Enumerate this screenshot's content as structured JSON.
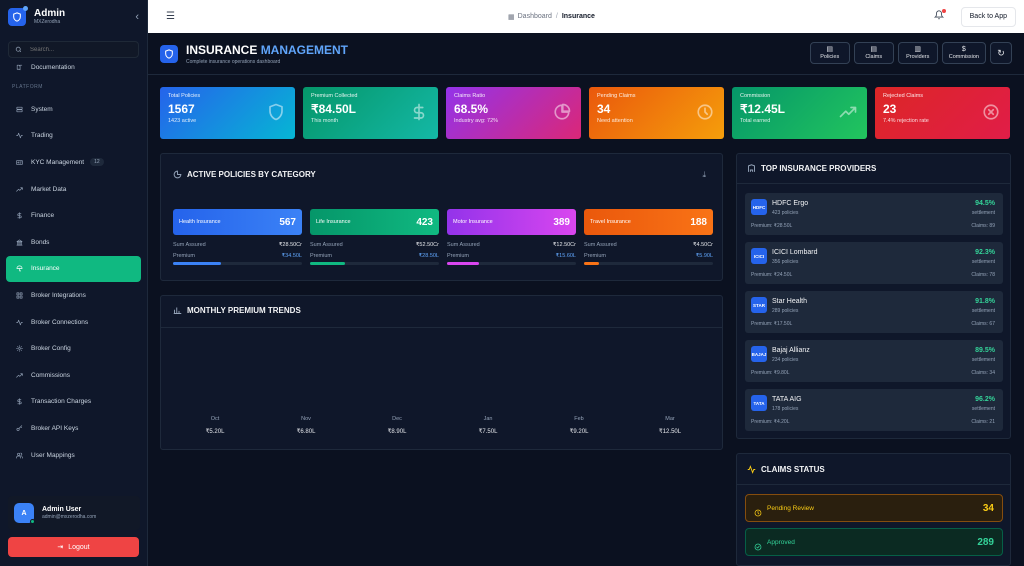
{
  "sidebar": {
    "brand_title": "Admin",
    "brand_sub": "MXZerodha",
    "search_placeholder": "Search...",
    "top_items": [
      {
        "label": "Documentation",
        "icon": "book-icon"
      }
    ],
    "section_label": "PLATFORM",
    "items": [
      {
        "label": "System",
        "icon": "server-icon"
      },
      {
        "label": "Trading",
        "icon": "activity-icon"
      },
      {
        "label": "KYC Management",
        "icon": "id-card-icon",
        "badge": "12"
      },
      {
        "label": "Market Data",
        "icon": "trending-up-icon"
      },
      {
        "label": "Finance",
        "icon": "dollar-icon"
      },
      {
        "label": "Bonds",
        "icon": "bank-icon"
      },
      {
        "label": "Insurance",
        "icon": "umbrella-icon",
        "active": true
      },
      {
        "label": "Broker Integrations",
        "icon": "grid-icon"
      },
      {
        "label": "Broker Connections",
        "icon": "activity-icon"
      },
      {
        "label": "Broker Config",
        "icon": "gear-icon"
      },
      {
        "label": "Commissions",
        "icon": "trending-up-icon"
      },
      {
        "label": "Transaction Charges",
        "icon": "dollar-icon"
      },
      {
        "label": "Broker API Keys",
        "icon": "key-icon"
      },
      {
        "label": "User Mappings",
        "icon": "users-icon"
      }
    ],
    "user": {
      "initial": "A",
      "name": "Admin User",
      "email": "admin@mxzerodha.com"
    },
    "logout_label": "Logout"
  },
  "topbar": {
    "breadcrumb_home": "Dashboard",
    "breadcrumb_current": "Insurance",
    "back_label": "Back to App"
  },
  "header": {
    "title_main": "INSURANCE",
    "title_accent": "MANAGEMENT",
    "subtitle": "Complete insurance operations dashboard",
    "actions": [
      "Policies",
      "Claims",
      "Providers",
      "Commission"
    ]
  },
  "stats": [
    {
      "label": "Total Policies",
      "value": "1567",
      "sub": "1423 active",
      "color_from": "#2563eb",
      "color_to": "#06b6d4",
      "icon": "shield-icon"
    },
    {
      "label": "Premium Collected",
      "value": "₹84.50L",
      "sub": "This month",
      "color_from": "#059669",
      "color_to": "#14b8a6",
      "icon": "dollar-icon"
    },
    {
      "label": "Claims Ratio",
      "value": "68.5%",
      "sub": "Industry avg: 72%",
      "color_from": "#9333ea",
      "color_to": "#db2777",
      "icon": "pie-chart-icon"
    },
    {
      "label": "Pending Claims",
      "value": "34",
      "sub": "Need attention",
      "color_from": "#ea580c",
      "color_to": "#f59e0b",
      "icon": "clock-icon"
    },
    {
      "label": "Commission",
      "value": "₹12.45L",
      "sub": "Total earned",
      "color_from": "#059669",
      "color_to": "#22c55e",
      "icon": "trending-up-icon"
    },
    {
      "label": "Rejected Claims",
      "value": "23",
      "sub": "7.4% rejection rate",
      "color_from": "#dc2626",
      "color_to": "#e11d48",
      "icon": "x-circle-icon"
    }
  ],
  "categories_panel": {
    "title": "ACTIVE POLICIES BY CATEGORY",
    "sum_label": "Sum Assured",
    "premium_label": "Premium",
    "items": [
      {
        "name": "Health Insurance",
        "count": "567",
        "sum": "₹28.50Cr",
        "premium": "₹34.50L",
        "bar": 0.37,
        "color": "#2563eb",
        "bar_color": "#3b82f6"
      },
      {
        "name": "Life Insurance",
        "count": "423",
        "sum": "₹52.50Cr",
        "premium": "₹28.50L",
        "bar": 0.27,
        "color": "#059669",
        "bar_color": "#10b981"
      },
      {
        "name": "Motor Insurance",
        "count": "389",
        "sum": "₹12.50Cr",
        "premium": "₹15.60L",
        "bar": 0.25,
        "color": "#9333ea",
        "bar_color": "#d946ef"
      },
      {
        "name": "Travel Insurance",
        "count": "188",
        "sum": "₹4.50Cr",
        "premium": "₹5.90L",
        "bar": 0.12,
        "color": "#ea580c",
        "bar_color": "#f97316"
      }
    ]
  },
  "trends_panel": {
    "title": "MONTHLY PREMIUM TRENDS",
    "months": [
      {
        "m": "Oct",
        "v": "₹5.20L"
      },
      {
        "m": "Nov",
        "v": "₹6.80L"
      },
      {
        "m": "Dec",
        "v": "₹8.90L"
      },
      {
        "m": "Jan",
        "v": "₹7.50L"
      },
      {
        "m": "Feb",
        "v": "₹9.20L"
      },
      {
        "m": "Mar",
        "v": "₹12.50L"
      }
    ]
  },
  "providers_panel": {
    "title": "TOP INSURANCE PROVIDERS",
    "settlement_label": "settlement",
    "providers": [
      {
        "logo": "HDFC",
        "name": "HDFC Ergo",
        "policies": "423 policies",
        "rate": "94.5%",
        "premium": "Premium: ₹28.50L",
        "claims": "Claims: 89"
      },
      {
        "logo": "ICICI",
        "name": "ICICI Lombard",
        "policies": "356 policies",
        "rate": "92.3%",
        "premium": "Premium: ₹24.50L",
        "claims": "Claims: 78"
      },
      {
        "logo": "STAR",
        "name": "Star Health",
        "policies": "289 policies",
        "rate": "91.8%",
        "premium": "Premium: ₹17.50L",
        "claims": "Claims: 67"
      },
      {
        "logo": "BAJAJ",
        "name": "Bajaj Allianz",
        "policies": "234 policies",
        "rate": "89.5%",
        "premium": "Premium: ₹9.80L",
        "claims": "Claims: 34"
      },
      {
        "logo": "TATA",
        "name": "TATA AIG",
        "policies": "178 policies",
        "rate": "96.2%",
        "premium": "Premium: ₹4.20L",
        "claims": "Claims: 21"
      }
    ]
  },
  "claims_panel": {
    "title": "CLAIMS STATUS",
    "rows": [
      {
        "label": "Pending Review",
        "value": "34",
        "bg": "#2a1f0e",
        "border": "#854d0e",
        "color": "#facc15"
      },
      {
        "label": "Approved",
        "value": "289",
        "bg": "#0b2a22",
        "border": "#065f46",
        "color": "#34d399"
      }
    ]
  }
}
